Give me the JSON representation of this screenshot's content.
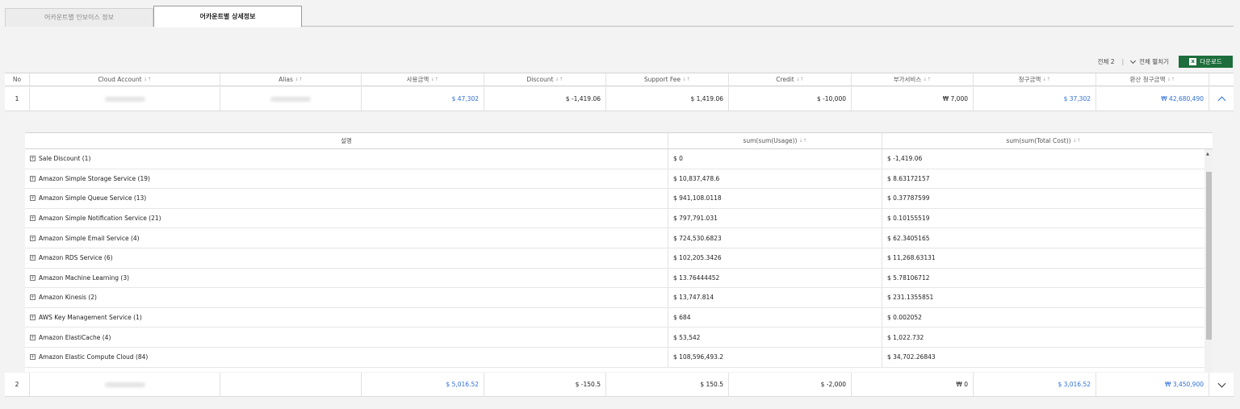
{
  "tabs": [
    {
      "label": "어카운트별 인보이스 정보",
      "active": false
    },
    {
      "label": "어카운트별 상세정보",
      "active": true
    }
  ],
  "toolbar": {
    "total_label": "전체 2",
    "expand_label": "전체 펼치기",
    "download_label": "다운로드",
    "download_icon": "excel-icon",
    "download_color": "#1d6e3c"
  },
  "table": {
    "headers": [
      "No",
      "Cloud Account",
      "Alias",
      "사용금액",
      "Discount",
      "Support Fee",
      "Credit",
      "부가서비스",
      "청구금액",
      "환산 청구금액"
    ],
    "sort_glyph": "↓↑",
    "rows": [
      {
        "no": "1",
        "usage": "$ 47,302",
        "discount": "$ -1,419.06",
        "support": "$ 1,419.06",
        "credit": "$ -10,000",
        "addon": "₩ 7,000",
        "billed": "$ 37,302",
        "converted": "₩ 42,680,490",
        "expanded": true
      },
      {
        "no": "2",
        "usage": "$ 5,016.52",
        "discount": "$ -150.5",
        "support": "$ 150.5",
        "credit": "$ -2,000",
        "addon": "₩ 0",
        "billed": "$ 3,016.52",
        "converted": "₩ 3,450,900",
        "expanded": false
      }
    ]
  },
  "detail": {
    "headers": [
      "설명",
      "sum(sum(Usage))",
      "sum(sum(Total Cost))"
    ],
    "rows": [
      {
        "name": "Sale Discount (1)",
        "usage": "$ 0",
        "cost": "$ -1,419.06"
      },
      {
        "name": "Amazon Simple Storage Service (19)",
        "usage": "$ 10,837,478.6",
        "cost": "$ 8.63172157"
      },
      {
        "name": "Amazon Simple Queue Service (13)",
        "usage": "$ 941,108.0118",
        "cost": "$ 0.37787599"
      },
      {
        "name": "Amazon Simple Notification Service (21)",
        "usage": "$ 797,791.031",
        "cost": "$ 0.10155519"
      },
      {
        "name": "Amazon Simple Email Service (4)",
        "usage": "$ 724,530.6823",
        "cost": "$ 62.3405165"
      },
      {
        "name": "Amazon RDS Service (6)",
        "usage": "$ 102,205.3426",
        "cost": "$ 11,268.63131"
      },
      {
        "name": "Amazon Machine Learning (3)",
        "usage": "$ 13.76444452",
        "cost": "$ 5.78106712"
      },
      {
        "name": "Amazon Kinesis (2)",
        "usage": "$ 13,747.814",
        "cost": "$ 231.1355851"
      },
      {
        "name": "AWS Key Management Service (1)",
        "usage": "$ 684",
        "cost": "$ 0.002052"
      },
      {
        "name": "Amazon ElastiCache (4)",
        "usage": "$ 53,542",
        "cost": "$ 1,022.732"
      },
      {
        "name": "Amazon Elastic Compute Cloud (84)",
        "usage": "$ 108,596,493.2",
        "cost": "$ 34,702.26843"
      }
    ]
  },
  "colors": {
    "accent_blue": "#2f6ed8",
    "download_green": "#1d6e3c"
  }
}
